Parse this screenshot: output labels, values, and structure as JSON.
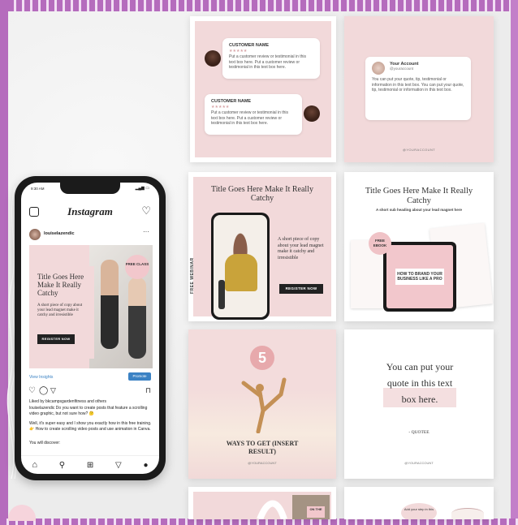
{
  "phone": {
    "status_time": "9:30 AM",
    "app_title": "Instagram",
    "username": "louiselazendic",
    "post": {
      "title": "Title Goes Here Make It Really Catchy",
      "body": "A short piece of copy about your lead magnet make it catchy and irresistible",
      "button": "REGISTER NOW",
      "badge": "FREE CLASS"
    },
    "view_insights": "View Insights",
    "promote": "Promote",
    "liked_by": "Liked by bkcampsgardenfitness and others",
    "caption_1": "louiselazendic Do you want to create posts that feature a scrolling video graphic, but not sure how? 🤔",
    "caption_2": "Well, it's super easy and I show you exactly how in this free training. 👉 How to create scrolling video posts and use animation in Canva.",
    "caption_3": "You will discover:"
  },
  "cards": {
    "review": {
      "name1": "CUSTOMER NAME",
      "stars": "★★★★★",
      "text1": "Put a customer review or testimonial in this text box here. Put a customer review or testimonial in this text box here.",
      "name2": "CUSTOMER NAME",
      "text2": "Put a customer review or testimonial in this text box here. Put a customer review or testimonial in this text box here."
    },
    "account": {
      "name": "Your Account",
      "handle": "@youraccount",
      "text": "You can put your quote, tip, testimonial or information in this text box. You can put your quote, tip, testimonial or information in this text box.",
      "footer": "@YOURACCOUNT"
    },
    "webinar": {
      "title": "Title Goes Here Make It Really Catchy",
      "body": "A short piece of copy about your lead magnet make it catchy and irresistible",
      "button": "REGISTER NOW",
      "side_label": "FREE WEBINAR"
    },
    "ebook": {
      "title": "Title Goes Here Make It Really Catchy",
      "subtitle": "A short sub heading about your lead magnet here",
      "badge": "FREE EBOOK",
      "tablet_text": "HOW TO BRAND YOUR BUSINESS LIKE A PRO"
    },
    "ways": {
      "number": "5",
      "title": "WAYS TO GET (INSERT RESULT)",
      "footer": "@YOURACCOUNT"
    },
    "quote": {
      "text": "You can put your quote in this text box here.",
      "author": "- QUOTEE",
      "footer": "@YOURACCOUNT"
    },
    "bottom": {
      "badge": "ON THE",
      "step": "Add your step in this"
    }
  },
  "colors": {
    "frame": "#b56cbd",
    "pink": "#f2d9da",
    "accent": "#e6a8ab"
  }
}
